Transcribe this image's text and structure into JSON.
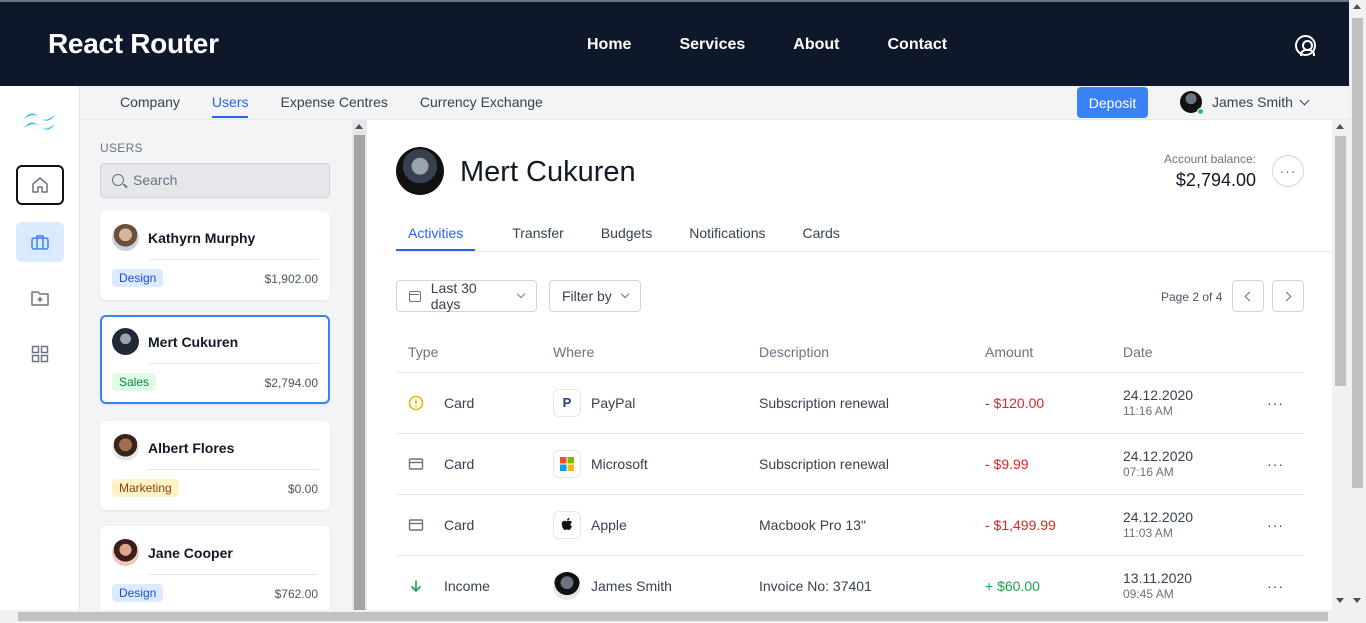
{
  "app": {
    "brand": "React Router",
    "nav": [
      "Home",
      "Services",
      "About",
      "Contact"
    ]
  },
  "subnav": {
    "tabs": [
      "Company",
      "Users",
      "Expense Centres",
      "Currency Exchange"
    ],
    "active_tab": "Users",
    "deposit_label": "Deposit",
    "account_name": "James Smith"
  },
  "users_panel": {
    "title": "USERS",
    "search_placeholder": "Search",
    "users": [
      {
        "name": "Kathyrn Murphy",
        "tag": "Design",
        "amount": "$1,902.00"
      },
      {
        "name": "Mert Cukuren",
        "tag": "Sales",
        "amount": "$2,794.00",
        "selected": true
      },
      {
        "name": "Albert Flores",
        "tag": "Marketing",
        "amount": "$0.00"
      },
      {
        "name": "Jane Cooper",
        "tag": "Design",
        "amount": "$762.00"
      }
    ]
  },
  "profile": {
    "name": "Mert Cukuren",
    "balance_label": "Account balance:",
    "balance_value": "$2,794.00",
    "more_label": "···",
    "tabs": [
      "Activities",
      "Transfer",
      "Budgets",
      "Notifications",
      "Cards"
    ],
    "active_tab": "Activities"
  },
  "filters": {
    "date_range": "Last 30 days",
    "filter_by": "Filter by",
    "page_info": "Page 2 of 4"
  },
  "table": {
    "headers": [
      "Type",
      "Where",
      "Description",
      "Amount",
      "Date"
    ],
    "rows": [
      {
        "type": "Card",
        "type_icon": "warning-icon",
        "where": "PayPal",
        "where_icon": "paypal-logo",
        "description": "Subscription renewal",
        "amount": "- $120.00",
        "date": "24.12.2020",
        "time": "11:16 AM",
        "more": "···"
      },
      {
        "type": "Card",
        "type_icon": "card-icon",
        "where": "Microsoft",
        "where_icon": "microsoft-logo",
        "description": "Subscription renewal",
        "amount": "- $9.99",
        "date": "24.12.2020",
        "time": "07:16 AM",
        "more": "···"
      },
      {
        "type": "Card",
        "type_icon": "card-icon",
        "where": "Apple",
        "where_icon": "apple-logo",
        "description": "Macbook Pro 13\"",
        "amount": "- $1,499.99",
        "date": "24.12.2020",
        "time": "11:03 AM",
        "more": "···"
      },
      {
        "type": "Income",
        "type_icon": "arrow-down-icon",
        "where": "James Smith",
        "where_icon": "avatar",
        "description": "Invoice No: 37401",
        "amount": "+ $60.00",
        "date": "13.11.2020",
        "time": "09:45 AM",
        "more": "···"
      }
    ]
  },
  "colors": {
    "nav_bg": "#0f172a",
    "accent": "#3b82f6",
    "negative": "#dc2626",
    "positive": "#16a34a"
  }
}
